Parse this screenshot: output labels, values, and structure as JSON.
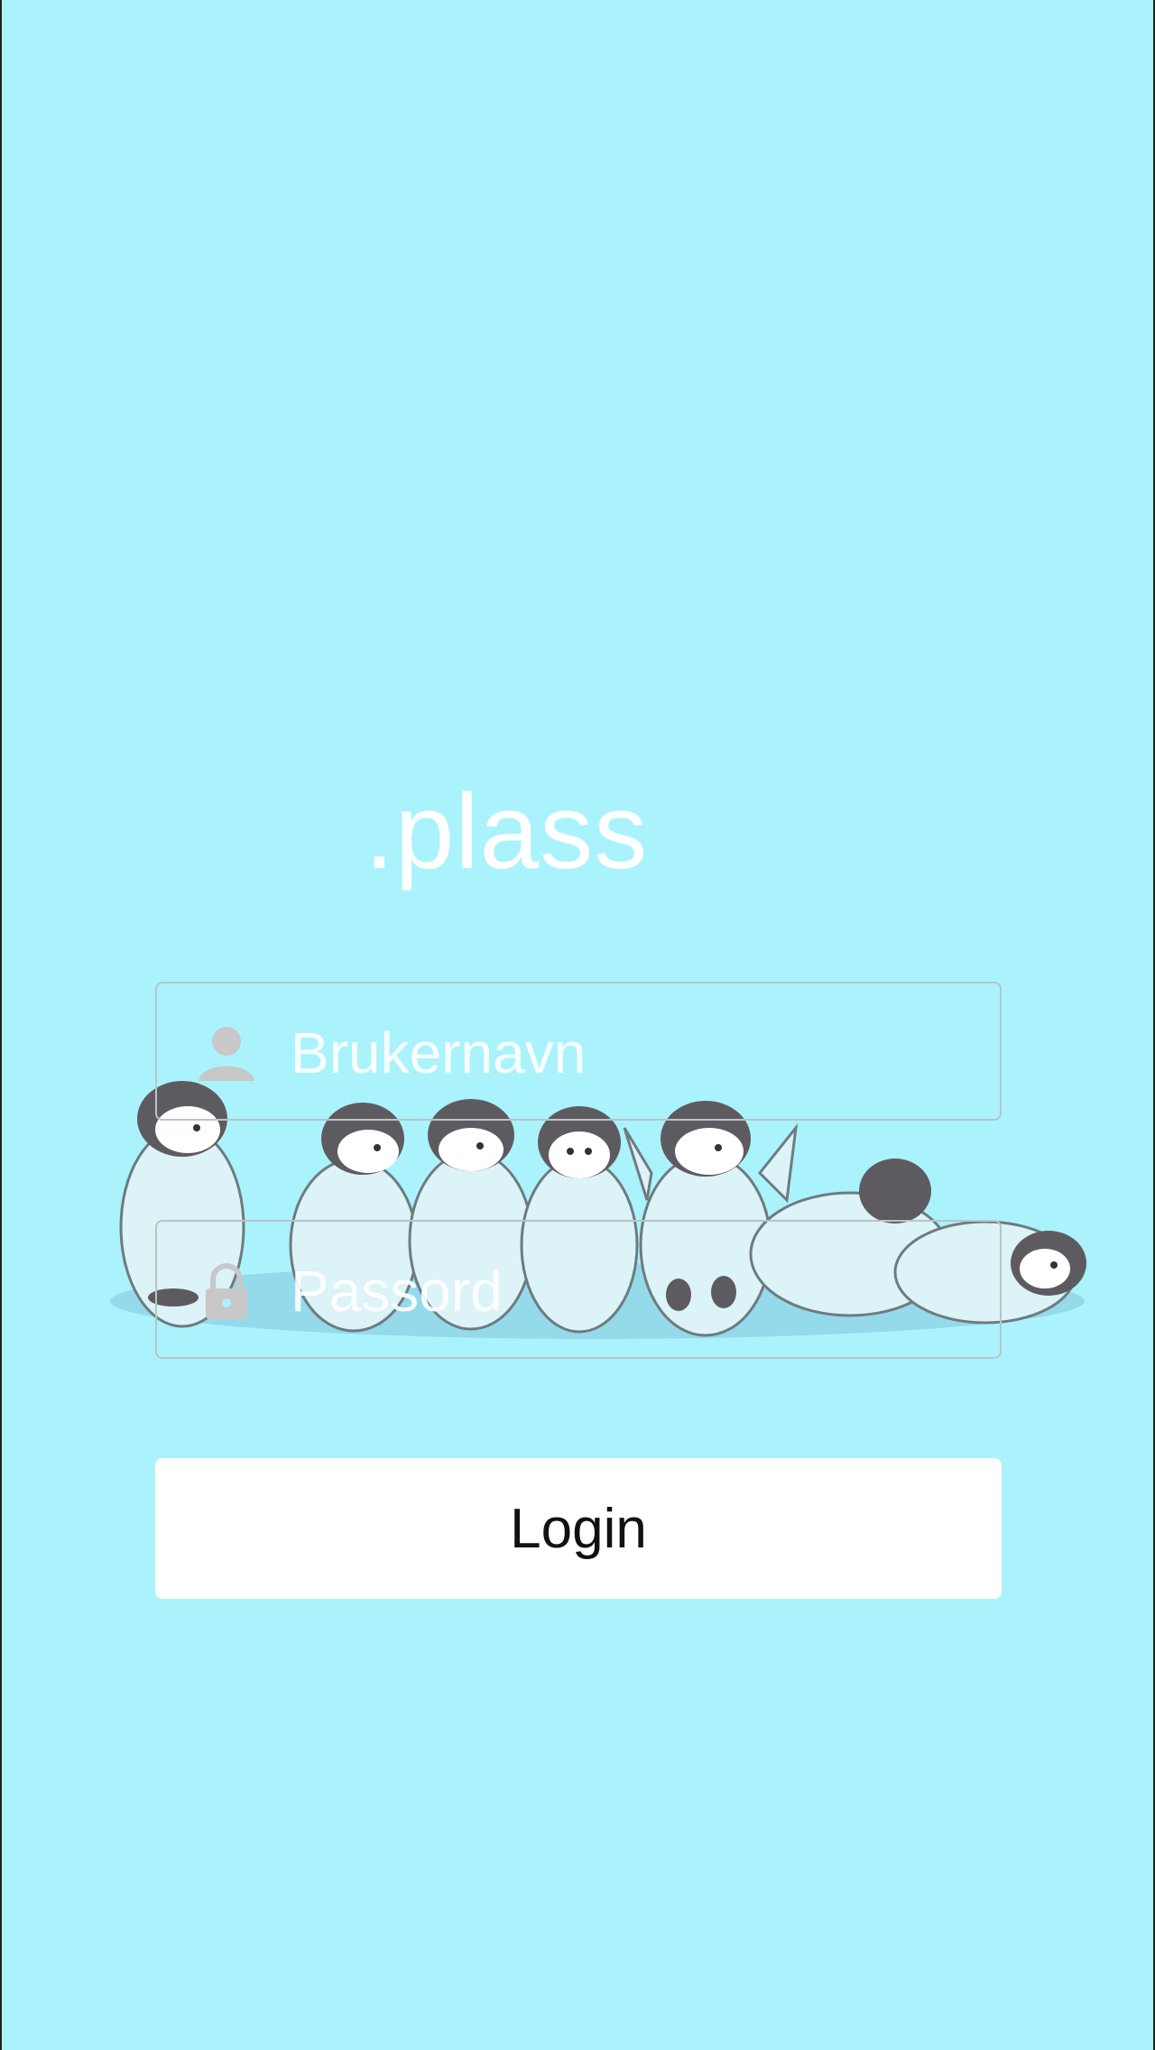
{
  "app": {
    "title": ".plass"
  },
  "form": {
    "username": {
      "placeholder": "Brukernavn",
      "icon": "user-icon"
    },
    "password": {
      "placeholder": "Passord",
      "icon": "lock-icon"
    },
    "login_label": "Login"
  },
  "colors": {
    "background": "#aaf3fc",
    "text_light": "#ffffff",
    "field_border": "#b9c4c6",
    "button_bg": "#ffffff",
    "button_text": "#111111"
  },
  "illustration": {
    "icon": "penguins-illustration"
  }
}
